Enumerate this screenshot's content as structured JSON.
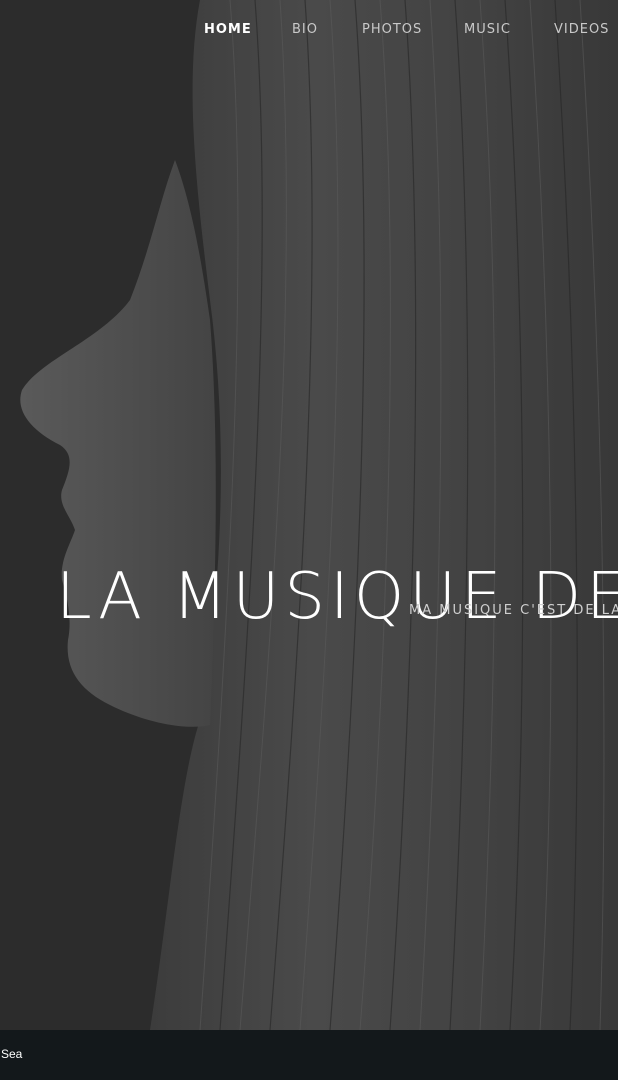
{
  "nav": {
    "items": [
      {
        "label": "HOME",
        "active": true
      },
      {
        "label": "BIO",
        "active": false
      },
      {
        "label": "PHOTOS",
        "active": false
      },
      {
        "label": "MUSIC",
        "active": false
      },
      {
        "label": "VIDEOS",
        "active": false
      }
    ]
  },
  "hero": {
    "title": "LA MUSIQUE DE",
    "subtitle": "MA MUSIQUE C'EST DE LA E",
    "image": "woman-profile-photo"
  },
  "bottom_bar": {
    "text": "Sea"
  },
  "colors": {
    "background": "#15191c",
    "hero_dark": "#2b2b2b",
    "text": "#ffffff",
    "nav_text": "#c9c9c9"
  }
}
